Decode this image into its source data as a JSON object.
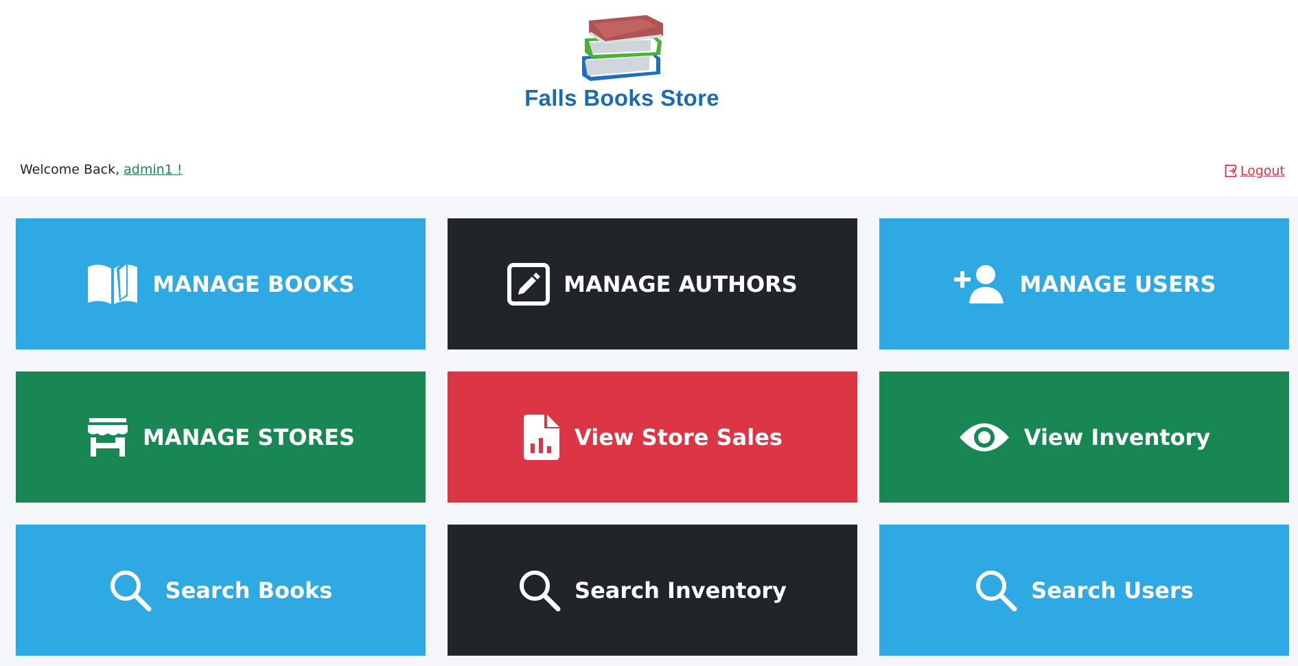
{
  "brand": {
    "name": "Falls Books Store",
    "logo_icon": "books-stack-icon"
  },
  "user_bar": {
    "welcome_prefix": "Welcome Back, ",
    "username": "admin1 !",
    "logout_label": "Logout",
    "logout_icon": "logout-icon"
  },
  "tiles": [
    {
      "label": "MANAGE BOOKS",
      "icon": "open-book-icon",
      "color": "#2ea9e3"
    },
    {
      "label": "MANAGE AUTHORS",
      "icon": "edit-square-icon",
      "color": "#212529"
    },
    {
      "label": "MANAGE USERS",
      "icon": "user-plus-icon",
      "color": "#2ea9e3"
    },
    {
      "label": "MANAGE STORES",
      "icon": "store-icon",
      "color": "#198754"
    },
    {
      "label": "View Store Sales",
      "icon": "report-file-icon",
      "color": "#dc3545"
    },
    {
      "label": "View Inventory",
      "icon": "eye-icon",
      "color": "#198754"
    },
    {
      "label": "Search Books",
      "icon": "search-icon",
      "color": "#2ea9e3"
    },
    {
      "label": "Search Inventory",
      "icon": "search-icon",
      "color": "#212529"
    },
    {
      "label": "Search Users",
      "icon": "search-icon",
      "color": "#2ea9e3"
    }
  ]
}
